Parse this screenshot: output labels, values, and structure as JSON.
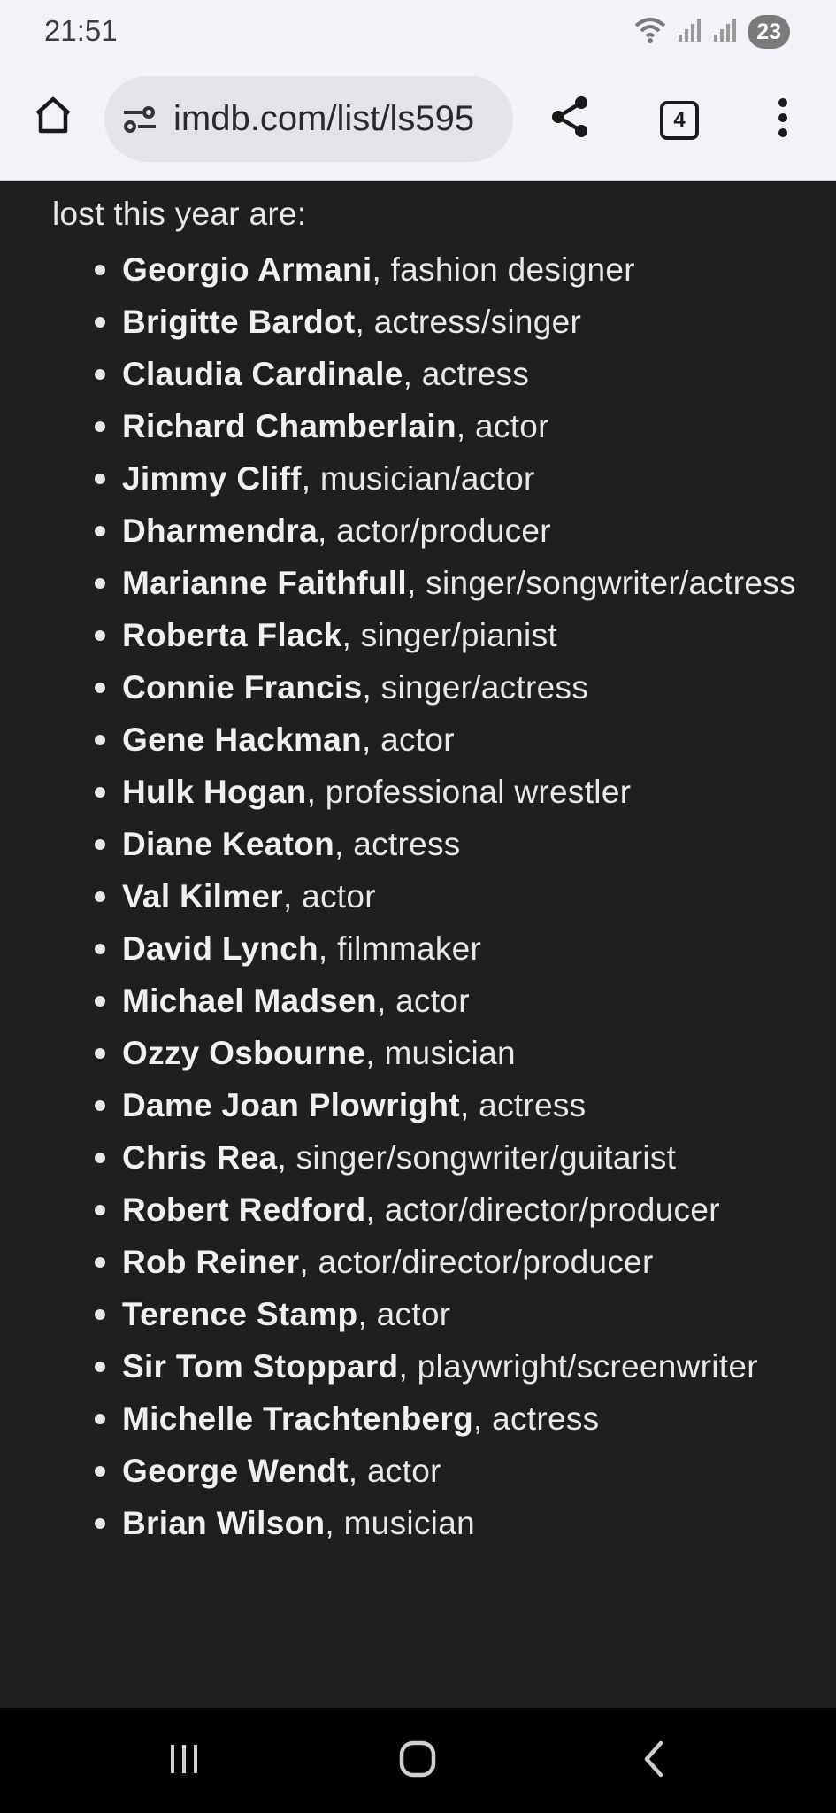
{
  "status_bar": {
    "time": "21:51",
    "battery": "23",
    "icons": [
      "wifi-icon",
      "signal-icon",
      "signal-icon",
      "battery-icon"
    ]
  },
  "toolbar": {
    "url": "imdb.com/list/ls595",
    "tab_count": "4",
    "icons": [
      "home-icon",
      "site-settings-icon",
      "share-icon",
      "tabs-icon",
      "more-vert-icon"
    ]
  },
  "content": {
    "intro": "lost this year are:",
    "items": [
      {
        "name": "Georgio Armani",
        "desc": ", fashion designer"
      },
      {
        "name": "Brigitte Bardot",
        "desc": ", actress/singer"
      },
      {
        "name": "Claudia Cardinale",
        "desc": ", actress"
      },
      {
        "name": "Richard Chamberlain",
        "desc": ", actor"
      },
      {
        "name": "Jimmy Cliff",
        "desc": ", musician/actor"
      },
      {
        "name": "Dharmendra",
        "desc": ", actor/producer"
      },
      {
        "name": "Marianne Faithfull",
        "desc": ", singer/songwriter/actress"
      },
      {
        "name": "Roberta Flack",
        "desc": ", singer/pianist"
      },
      {
        "name": "Connie Francis",
        "desc": ", singer/actress"
      },
      {
        "name": "Gene Hackman",
        "desc": ", actor"
      },
      {
        "name": "Hulk Hogan",
        "desc": ", professional wrestler"
      },
      {
        "name": "Diane Keaton",
        "desc": ", actress"
      },
      {
        "name": "Val Kilmer",
        "desc": ", actor"
      },
      {
        "name": "David Lynch",
        "desc": ", filmmaker"
      },
      {
        "name": "Michael Madsen",
        "desc": ", actor"
      },
      {
        "name": "Ozzy Osbourne",
        "desc": ", musician"
      },
      {
        "name": "Dame Joan Plowright",
        "desc": ", actress"
      },
      {
        "name": "Chris Rea",
        "desc": ", singer/songwriter/guitarist"
      },
      {
        "name": "Robert Redford",
        "desc": ", actor/director/producer"
      },
      {
        "name": "Rob Reiner",
        "desc": ", actor/director/producer"
      },
      {
        "name": "Terence Stamp",
        "desc": ", actor"
      },
      {
        "name": "Sir Tom Stoppard",
        "desc": ", playwright/screenwriter"
      },
      {
        "name": "Michelle Trachtenberg",
        "desc": ", actress"
      },
      {
        "name": "George Wendt",
        "desc": ", actor"
      },
      {
        "name": "Brian Wilson",
        "desc": ", musician"
      }
    ]
  },
  "nav_bar": {
    "icons": [
      "recent-apps-icon",
      "home-circle-icon",
      "back-icon"
    ]
  },
  "colors": {
    "page_background": "#1f1f1f",
    "text": "#e8e8e8",
    "chrome_background": "#f3f2f8",
    "url_bar": "#e3e3e9"
  }
}
